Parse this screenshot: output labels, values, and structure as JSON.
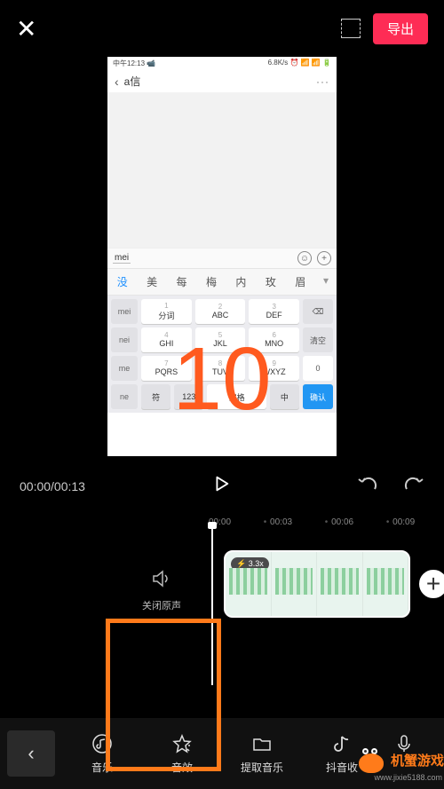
{
  "topbar": {
    "close": "✕",
    "export": "导出"
  },
  "phone": {
    "status_left": "中午12:13  📹",
    "status_right": "6.8K/s ⏰ 📶 📶 🔋",
    "back": "‹",
    "title": "a信",
    "dots": "···",
    "input_text": "mei",
    "candidates": {
      "c0": "没",
      "c1": "美",
      "c2": "每",
      "c3": "梅",
      "c4": "内",
      "c5": "玫",
      "c6": "眉",
      "arrow": "▾"
    },
    "side": {
      "s0": "mei",
      "s1": "nei",
      "s2": "me",
      "s3": "ne"
    },
    "keys": {
      "k1n": "1",
      "k1": "分词",
      "k2n": "2",
      "k2": "ABC",
      "k3n": "3",
      "k3": "DEF",
      "k4n": "4",
      "k4": "GHI",
      "k5n": "5",
      "k5": "JKL",
      "k6n": "6",
      "k6": "MNO",
      "k7n": "7",
      "k7": "PQRS",
      "k8n": "8",
      "k8": "TUV",
      "k9n": "9",
      "k9": "WXYZ",
      "sym": "符",
      "num": "123",
      "space": "空格",
      "cn": "中"
    },
    "right": {
      "del": "⌫",
      "clear": "清空",
      "zero": "0",
      "confirm": "确认"
    }
  },
  "overlay": {
    "number": "10"
  },
  "controls": {
    "time": "00:00/00:13"
  },
  "ruler": {
    "t0": "00:00",
    "t1": "00:03",
    "t2": "00:06",
    "t3": "00:09"
  },
  "mute": {
    "label": "关闭原声"
  },
  "clip": {
    "speed": "⚡ 3.3x"
  },
  "add": "+",
  "toolbar": {
    "back": "‹",
    "items": {
      "i0": "音乐",
      "i1": "音效",
      "i2": "提取音乐",
      "i3": "抖音收"
    }
  },
  "watermark": {
    "text": "机蟹游戏",
    "sub": "www.jixie5188.com"
  }
}
